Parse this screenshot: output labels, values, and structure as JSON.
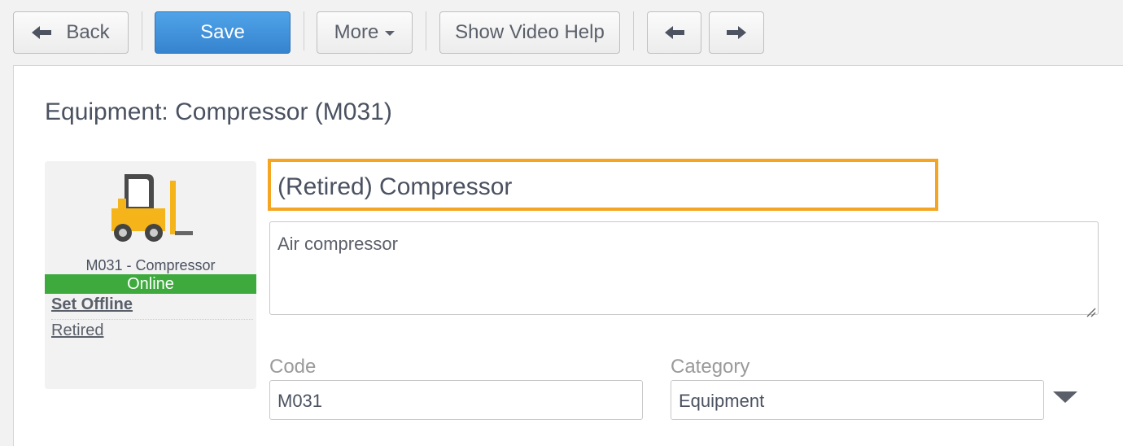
{
  "toolbar": {
    "back_label": "Back",
    "back_icon": "arrow-left-icon",
    "save_label": "Save",
    "more_label": "More",
    "video_help_label": "Show Video Help",
    "prev_icon": "arrow-left-icon",
    "next_icon": "arrow-right-icon"
  },
  "page": {
    "title": "Equipment: Compressor (M031)"
  },
  "asset_card": {
    "image_icon": "forklift-icon",
    "label": "M031 - Compressor",
    "status": "Online",
    "status_color": "#3eaa3e",
    "set_offline_link": "Set Offline",
    "retired_link": "Retired"
  },
  "form": {
    "name_value": "(Retired) Compressor",
    "name_highlight_color": "#f5a524",
    "description_value": "Air compressor",
    "code_label": "Code",
    "code_value": "M031",
    "category_label": "Category",
    "category_value": "Equipment"
  },
  "colors": {
    "primary_button": "#3683cf",
    "status_online": "#3eaa3e",
    "highlight": "#f5a524"
  }
}
